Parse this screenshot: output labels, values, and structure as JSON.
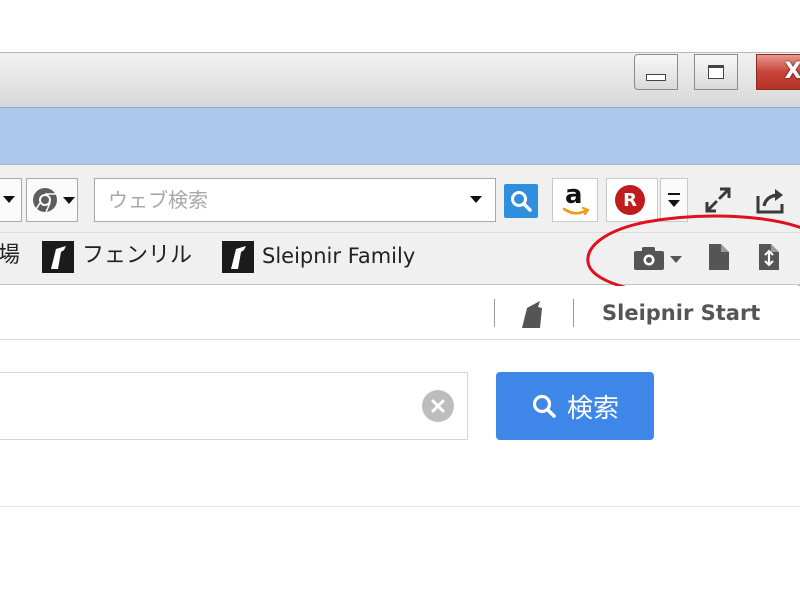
{
  "toolbar": {
    "search_placeholder": "ウェブ検索",
    "amazon_label": "a",
    "rakuten_label": "R"
  },
  "window": {
    "close_label": "X"
  },
  "bookmarks": {
    "partial_label": "場",
    "items": [
      {
        "label": "フェンリル"
      },
      {
        "label": "Sleipnir Family"
      }
    ]
  },
  "tabs": {
    "active_label": "Sleipnir Start"
  },
  "content": {
    "search_button_label": "検索"
  },
  "colors": {
    "title_band": "#adc8ea",
    "search_accent": "#3e86e8",
    "annotation": "#e0101e"
  }
}
